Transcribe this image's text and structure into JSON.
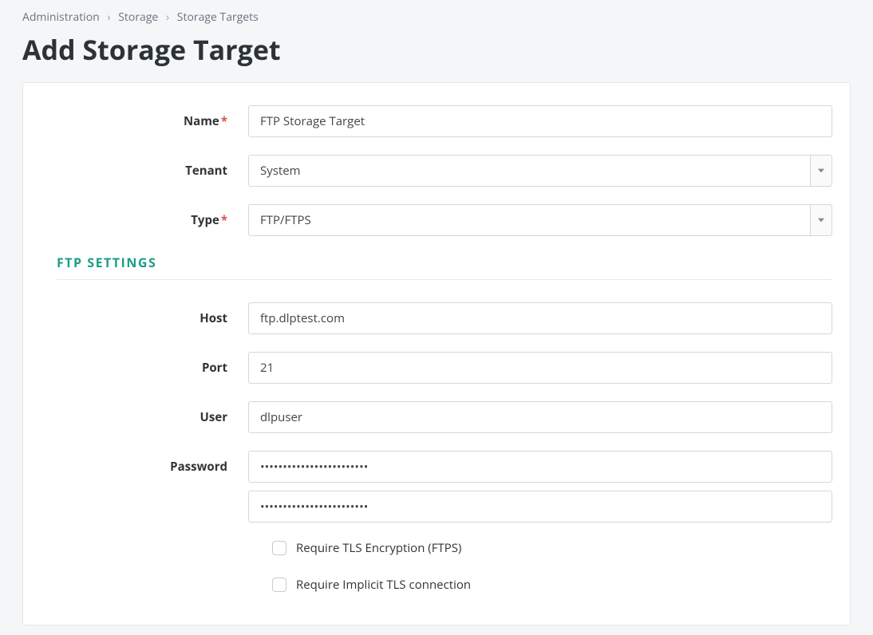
{
  "breadcrumb": {
    "items": [
      "Administration",
      "Storage",
      "Storage Targets"
    ]
  },
  "page_title": "Add Storage Target",
  "form": {
    "name_label": "Name",
    "name_value": "FTP Storage Target",
    "tenant_label": "Tenant",
    "tenant_value": "System",
    "type_label": "Type",
    "type_value": "FTP/FTPS"
  },
  "ftp_section": {
    "heading": "FTP SETTINGS",
    "host_label": "Host",
    "host_value": "ftp.dlptest.com",
    "port_label": "Port",
    "port_value": "21",
    "user_label": "User",
    "user_value": "dlpuser",
    "password_label": "Password",
    "password_value": "••••••••••••••••••••••••",
    "password_confirm_value": "••••••••••••••••••••••••",
    "tls_label": "Require TLS Encryption (FTPS)",
    "tls_checked": false,
    "implicit_tls_label": "Require Implicit TLS connection",
    "implicit_tls_checked": false
  },
  "required_marker": "*"
}
